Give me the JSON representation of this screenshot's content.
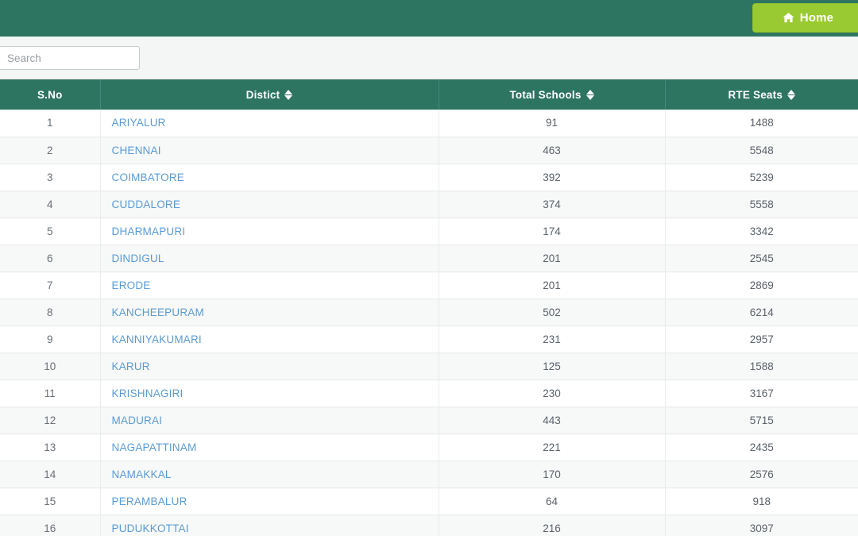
{
  "navbar": {
    "home_button_label": "Home",
    "home_icon": "home-icon",
    "background_color": "#2d7561",
    "button_color": "#9aca32"
  },
  "toolbar": {
    "search_placeholder": "Search",
    "search_value": ""
  },
  "table": {
    "columns": [
      {
        "key": "sno",
        "label": "S.No",
        "sortable": false
      },
      {
        "key": "district",
        "label": "Distict",
        "sortable": true
      },
      {
        "key": "schools",
        "label": "Total Schools",
        "sortable": true
      },
      {
        "key": "rte",
        "label": "RTE Seats",
        "sortable": true
      }
    ],
    "rows": [
      {
        "sno": "1",
        "district": "ARIYALUR",
        "schools": "91",
        "rte": "1488"
      },
      {
        "sno": "2",
        "district": "CHENNAI",
        "schools": "463",
        "rte": "5548"
      },
      {
        "sno": "3",
        "district": "COIMBATORE",
        "schools": "392",
        "rte": "5239"
      },
      {
        "sno": "4",
        "district": "CUDDALORE",
        "schools": "374",
        "rte": "5558"
      },
      {
        "sno": "5",
        "district": "DHARMAPURI",
        "schools": "174",
        "rte": "3342"
      },
      {
        "sno": "6",
        "district": "DINDIGUL",
        "schools": "201",
        "rte": "2545"
      },
      {
        "sno": "7",
        "district": "ERODE",
        "schools": "201",
        "rte": "2869"
      },
      {
        "sno": "8",
        "district": "KANCHEEPURAM",
        "schools": "502",
        "rte": "6214"
      },
      {
        "sno": "9",
        "district": "KANNIYAKUMARI",
        "schools": "231",
        "rte": "2957"
      },
      {
        "sno": "10",
        "district": "KARUR",
        "schools": "125",
        "rte": "1588"
      },
      {
        "sno": "11",
        "district": "KRISHNAGIRI",
        "schools": "230",
        "rte": "3167"
      },
      {
        "sno": "12",
        "district": "MADURAI",
        "schools": "443",
        "rte": "5715"
      },
      {
        "sno": "13",
        "district": "NAGAPATTINAM",
        "schools": "221",
        "rte": "2435"
      },
      {
        "sno": "14",
        "district": "NAMAKKAL",
        "schools": "170",
        "rte": "2576"
      },
      {
        "sno": "15",
        "district": "PERAMBALUR",
        "schools": "64",
        "rte": "918"
      },
      {
        "sno": "16",
        "district": "PUDUKKOTTAI",
        "schools": "216",
        "rte": "3097"
      }
    ]
  },
  "colors": {
    "header_green": "#2d7561",
    "button_green": "#9aca32",
    "link_blue": "#5b9bd5",
    "row_alt": "#f7f8f8"
  }
}
